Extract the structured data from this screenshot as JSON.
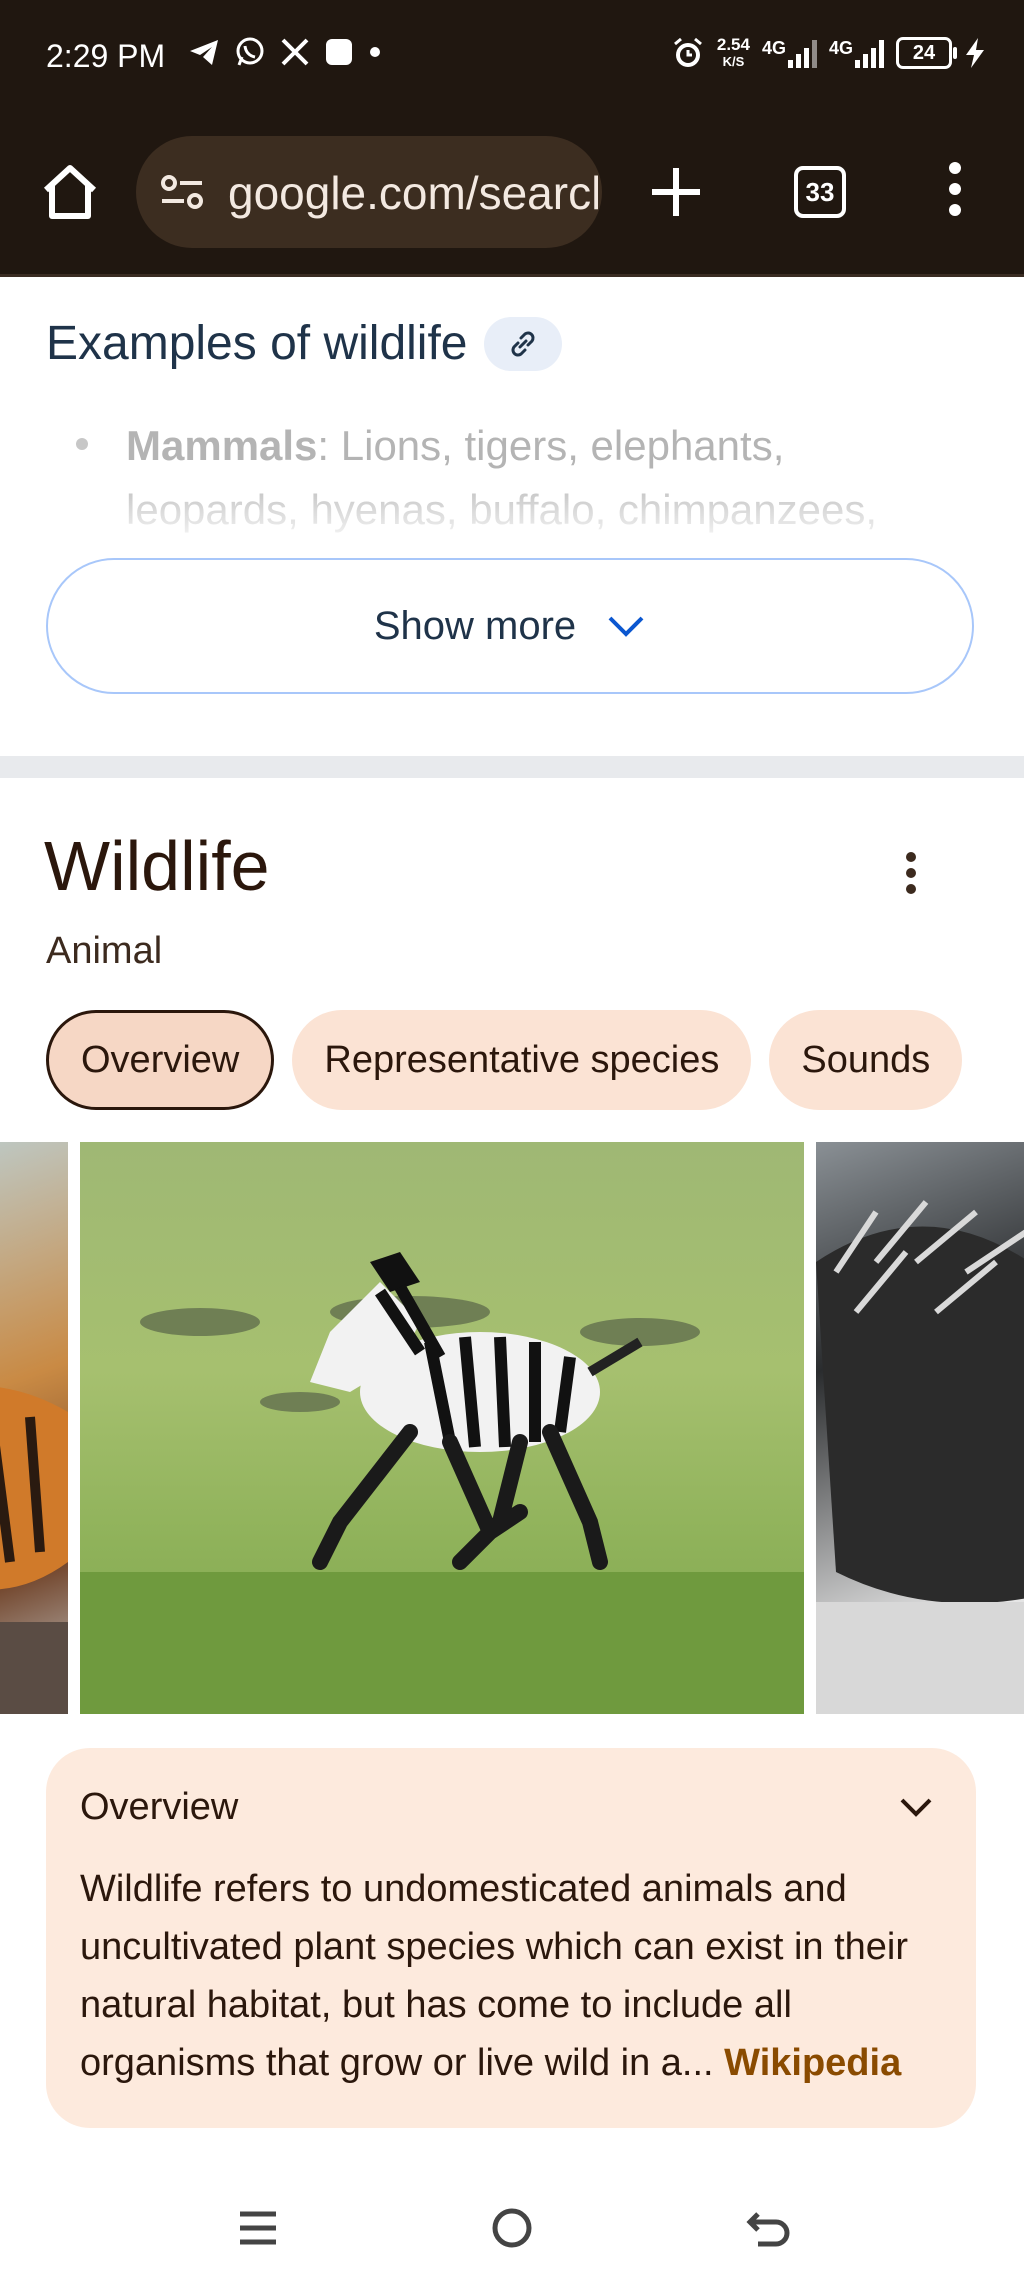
{
  "status_bar": {
    "time": "2:29 PM",
    "net_speed_value": "2.54",
    "net_speed_unit": "K/S",
    "network_1": "4G",
    "network_2": "4G",
    "battery": "24",
    "icons": [
      "telegram-icon",
      "whatsapp-icon",
      "x-icon",
      "app-icon",
      "dot-icon",
      "alarm-icon",
      "charging-icon"
    ]
  },
  "browser": {
    "url": "google.com/search",
    "tab_count": "33"
  },
  "examples": {
    "heading": "Examples of wildlife",
    "item_label": "Mammals",
    "item_text": ": Lions, tigers, elephants, leopards, hyenas, buffalo, chimpanzees,",
    "show_more": "Show more"
  },
  "knowledge_panel": {
    "title": "Wildlife",
    "subtitle": "Animal",
    "chips": [
      "Overview",
      "Representative species",
      "Sounds"
    ],
    "active_chip": "Overview",
    "images": [
      "tiger-image",
      "zebra-foal-image",
      "porcupine-image"
    ],
    "overview": {
      "title": "Overview",
      "text": "Wildlife refers to undomesticated animals and uncultivated plant species which can exist in their natural habitat, but has come to include all organisms that grow or live wild in a",
      "ellipsis": "...",
      "source": "Wikipedia"
    }
  },
  "colors": {
    "toolbar_bg": "#201710",
    "chip_bg": "#fbe3d4",
    "card_bg": "#fdeadd",
    "link": "#8a4b00",
    "heading": "#1f3349"
  }
}
